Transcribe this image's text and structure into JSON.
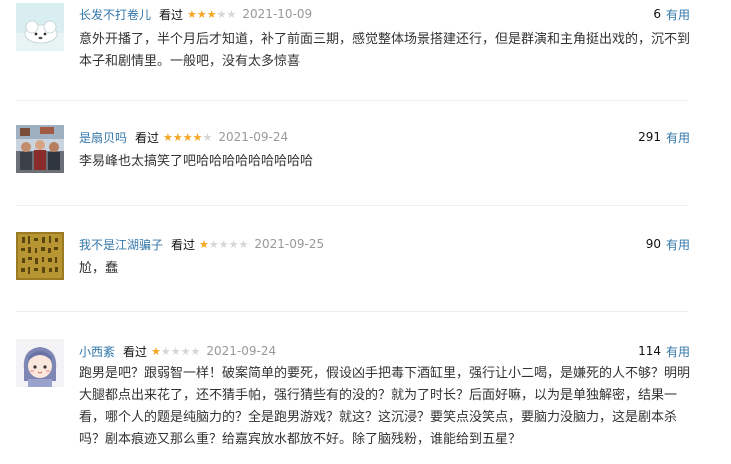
{
  "reviews": [
    {
      "user": "长发不打卷儿",
      "watched": "看过",
      "rating": 3,
      "date": "2021-10-09",
      "votes": "6",
      "vote_label": "有用",
      "content": "意外开播了，半个月后才知道，补了前面三期，感觉整体场景搭建还行，但是群演和主角挺出戏的，沉不到本子和剧情里。一般吧，没有太多惊喜"
    },
    {
      "user": "是扇贝吗",
      "watched": "看过",
      "rating": 4,
      "date": "2021-09-24",
      "votes": "291",
      "vote_label": "有用",
      "content": "李易峰也太搞笑了吧哈哈哈哈哈哈哈哈哈"
    },
    {
      "user": "我不是江湖骗子",
      "watched": "看过",
      "rating": 1,
      "date": "2021-09-25",
      "votes": "90",
      "vote_label": "有用",
      "content": "尬，蠢"
    },
    {
      "user": "小西紊",
      "watched": "看过",
      "rating": 1,
      "date": "2021-09-24",
      "votes": "114",
      "vote_label": "有用",
      "content": "跑男是吧？跟弱智一样！破案简单的要死，假设凶手把毒下酒缸里，强行让小二喝，是嫌死的人不够？明明大腿都点出来花了，还不猜手帕，强行猜些有的没的？就为了时长？后面好嘛，以为是单独解密，结果一看，哪个人的题是纯脑力的？全是跑男游戏？就这？这沉浸？要笑点没笑点，要脑力没脑力，这是剧本杀吗？剧本痕迹又那么重？给嘉宾放水都放不好。除了脑残粉，谁能给到五星？"
    }
  ]
}
